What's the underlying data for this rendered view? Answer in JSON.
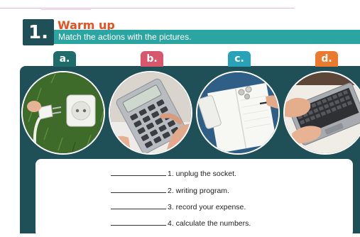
{
  "header": {
    "number": "1.",
    "title": "Warm up",
    "instruction": "Match the actions with the pictures."
  },
  "pictures": [
    {
      "label": "a.",
      "color": "#1f6d6a",
      "icon": "socket-plug-photo"
    },
    {
      "label": "b.",
      "color": "#d9576c",
      "icon": "calculator-photo"
    },
    {
      "label": "c.",
      "color": "#27a2b9",
      "icon": "notebook-pen-photo"
    },
    {
      "label": "d.",
      "color": "#ec7a2e",
      "icon": "laptop-typing-photo"
    }
  ],
  "items": [
    {
      "text": "1. unplug the socket."
    },
    {
      "text": "2. writing program."
    },
    {
      "text": "3. record your expense."
    },
    {
      "text": "4. calculate the numbers."
    }
  ]
}
